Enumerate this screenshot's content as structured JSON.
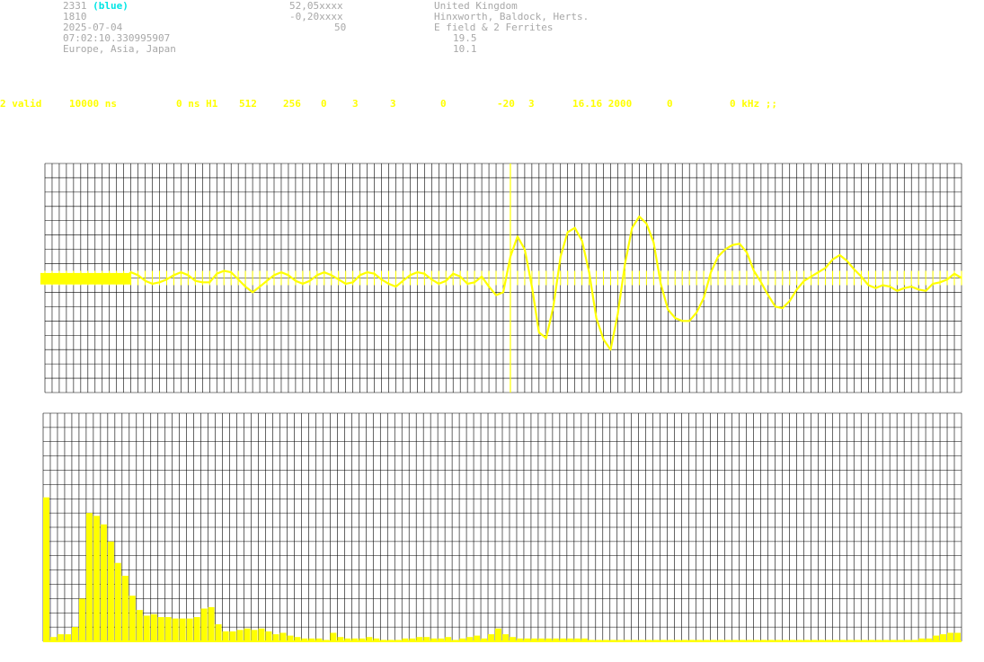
{
  "header": {
    "col1": {
      "station_id": "2331",
      "station_color": "(blue)",
      "line2": "1810",
      "date": "2025-07-04",
      "time": "07:02:10.330995907",
      "region": "Europe, Asia, Japan"
    },
    "col2": {
      "lat": "52,05xxxx",
      "lon": "-0,20xxxx",
      "value3": "50"
    },
    "col3": {
      "country": "United Kingdom",
      "place": "Hinxworth, Baldock, Herts.",
      "antenna": "E field & 2 Ferrites",
      "value4": "19.5",
      "value5": "10.1"
    }
  },
  "status_bar": [
    "2 valid",
    "10000 ns",
    "0 ns H1",
    "512",
    "256",
    "0",
    "3",
    "3",
    "0",
    "-20",
    "3",
    "16.16 2000",
    "0",
    "0 kHz ;;"
  ],
  "colors": {
    "signal": "#ffff00",
    "grid": "#000000",
    "text": "#a8a8a8",
    "station": "#00e5e5"
  },
  "chart_data": [
    {
      "type": "line",
      "title": "",
      "xlabel": "",
      "ylabel": "",
      "grid": true,
      "x_divisions": 128,
      "y_divisions": 16,
      "ylim": [
        -8,
        8
      ],
      "xlim": [
        0,
        128
      ],
      "trigger_marker_x": 65,
      "series": [
        {
          "x": [
            0,
            1,
            2,
            3,
            4,
            5,
            6,
            7,
            8,
            9,
            10,
            11,
            12,
            13,
            14,
            15,
            16,
            17,
            18,
            19,
            20,
            21,
            22,
            23,
            24,
            25,
            26,
            27,
            28,
            29,
            30,
            31,
            32,
            33,
            34,
            35,
            36,
            37,
            38,
            39,
            40,
            41,
            42,
            43,
            44,
            45,
            46,
            47,
            48,
            49,
            50,
            51,
            52,
            53,
            54,
            55,
            56,
            57,
            58,
            59,
            60,
            61,
            62,
            63,
            64,
            65,
            66,
            67,
            68,
            69,
            70,
            71,
            72,
            73,
            74,
            75,
            76,
            77,
            78,
            79,
            80,
            81,
            82,
            83,
            84,
            85,
            86,
            87,
            88,
            89,
            90,
            91,
            92,
            93,
            94,
            95,
            96,
            97,
            98,
            99,
            100,
            101,
            102,
            103,
            104,
            105,
            106,
            107,
            108,
            109,
            110,
            111,
            112,
            113,
            114,
            115,
            116,
            117,
            118,
            119,
            120,
            121,
            122,
            123,
            124,
            125,
            126,
            127,
            128
          ],
          "values": [
            -0.1,
            -0.1,
            -0.1,
            -0.1,
            -0.1,
            -0.1,
            -0.1,
            -0.1,
            -0.1,
            -0.1,
            -0.1,
            -0.1,
            0.4,
            0.2,
            -0.2,
            -0.4,
            -0.3,
            -0.1,
            0.2,
            0.4,
            0.2,
            -0.2,
            -0.3,
            -0.3,
            0.3,
            0.5,
            0.4,
            -0.1,
            -0.6,
            -1.0,
            -0.6,
            -0.2,
            0.2,
            0.4,
            0.2,
            -0.2,
            -0.4,
            -0.2,
            0.2,
            0.4,
            0.2,
            -0.1,
            -0.4,
            -0.3,
            0.2,
            0.4,
            0.3,
            -0.1,
            -0.4,
            -0.6,
            -0.2,
            0.2,
            0.4,
            0.3,
            -0.1,
            -0.4,
            -0.2,
            0.3,
            0.1,
            -0.4,
            -0.3,
            0.1,
            -0.6,
            -1.2,
            -1.0,
            1.5,
            2.9,
            2.0,
            -0.6,
            -3.8,
            -4.2,
            -2.0,
            1.5,
            3.2,
            3.5,
            2.6,
            0.4,
            -2.8,
            -4.3,
            -5.0,
            -2.5,
            1.0,
            3.5,
            4.3,
            3.8,
            2.5,
            -0.4,
            -2.2,
            -2.8,
            -3.0,
            -3.0,
            -2.4,
            -1.4,
            0.4,
            1.5,
            2.0,
            2.3,
            2.4,
            1.8,
            0.5,
            -0.3,
            -1.2,
            -2.0,
            -2.1,
            -1.6,
            -0.8,
            -0.2,
            0.1,
            0.4,
            0.7,
            1.3,
            1.6,
            1.2,
            0.6,
            0.1,
            -0.5,
            -0.7,
            -0.5,
            -0.6,
            -0.9,
            -0.7,
            -0.6,
            -0.8,
            -0.9,
            -0.4,
            -0.3,
            -0.1,
            0.3,
            0.0
          ]
        }
      ]
    },
    {
      "type": "bar",
      "title": "",
      "xlabel": "",
      "ylabel": "",
      "grid": true,
      "x_divisions": 128,
      "y_divisions": 16,
      "ylim": [
        0,
        16
      ],
      "xlim": [
        0,
        128
      ],
      "series": [
        {
          "values": [
            10.1,
            0.3,
            0.5,
            0.5,
            1.0,
            3.0,
            9.0,
            8.8,
            8.2,
            7.0,
            5.5,
            4.6,
            3.2,
            2.2,
            1.8,
            1.9,
            1.7,
            1.7,
            1.6,
            1.6,
            1.6,
            1.7,
            2.3,
            2.4,
            1.2,
            0.7,
            0.7,
            0.8,
            0.9,
            0.8,
            0.9,
            0.7,
            0.5,
            0.6,
            0.4,
            0.3,
            0.2,
            0.2,
            0.2,
            0.1,
            0.6,
            0.3,
            0.2,
            0.2,
            0.2,
            0.3,
            0.2,
            0.1,
            0.1,
            0.1,
            0.2,
            0.2,
            0.3,
            0.3,
            0.2,
            0.2,
            0.3,
            0.1,
            0.2,
            0.3,
            0.4,
            0.2,
            0.5,
            0.9,
            0.5,
            0.3,
            0.2,
            0.2,
            0.2,
            0.2,
            0.2,
            0.2,
            0.2,
            0.2,
            0.2,
            0.2,
            0.1,
            0.1,
            0.1,
            0.1,
            0.1,
            0.1,
            0.1,
            0.1,
            0.1,
            0.1,
            0.1,
            0.1,
            0.1,
            0.1,
            0.1,
            0.1,
            0.1,
            0.1,
            0.1,
            0.1,
            0.1,
            0.1,
            0.1,
            0.1,
            0.1,
            0.1,
            0.1,
            0.1,
            0.1,
            0.1,
            0.1,
            0.1,
            0.1,
            0.1,
            0.1,
            0.1,
            0.1,
            0.1,
            0.1,
            0.1,
            0.1,
            0.1,
            0.1,
            0.1,
            0.1,
            0.1,
            0.2,
            0.2,
            0.4,
            0.5,
            0.6,
            0.6
          ]
        }
      ]
    }
  ]
}
